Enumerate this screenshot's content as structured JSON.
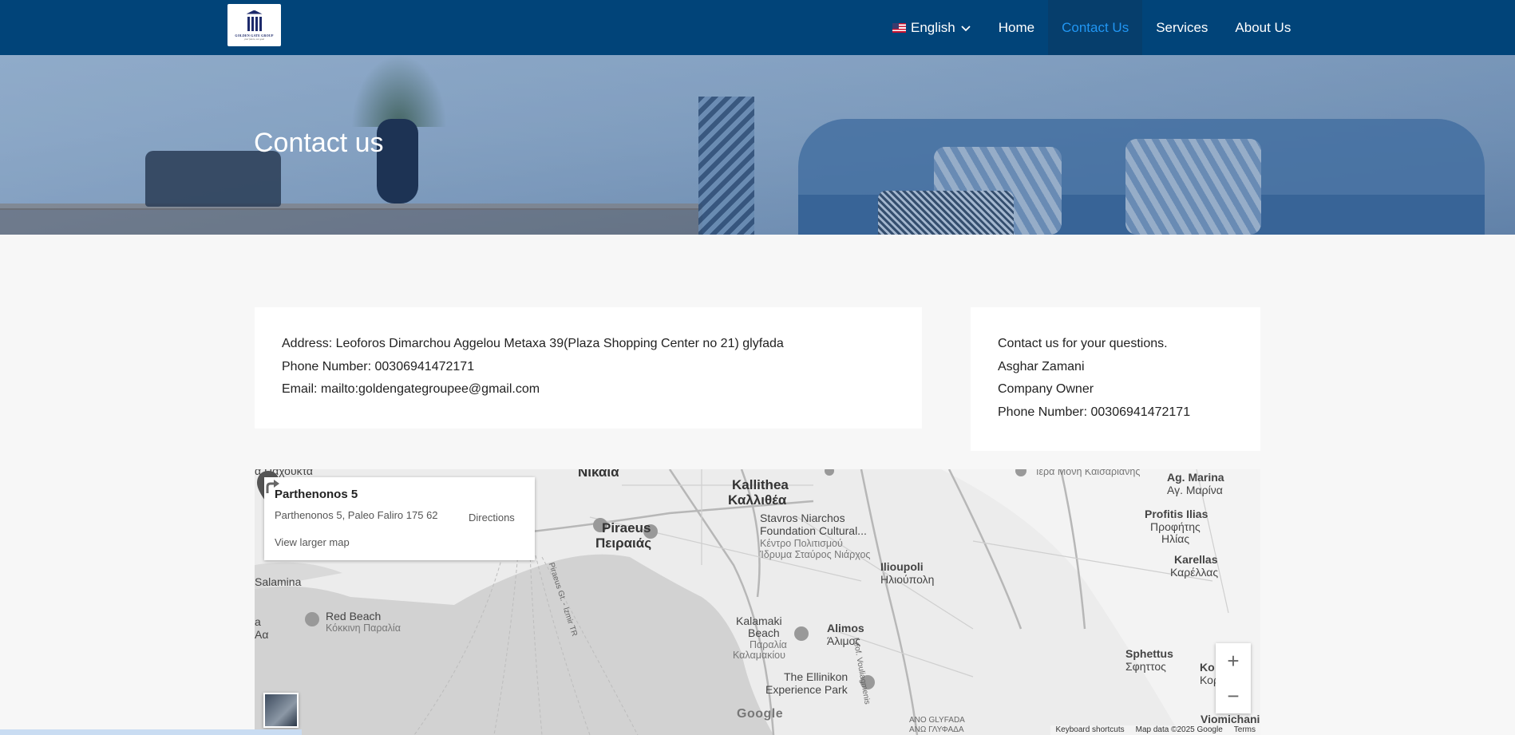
{
  "header": {
    "logo": {
      "text": "GOLDEN GATE GROUP",
      "tagline": "your future, our goal"
    },
    "language": {
      "label": "English",
      "flag": "us-flag-icon"
    },
    "nav": [
      {
        "label": "Home",
        "active": false
      },
      {
        "label": "Contact Us",
        "active": true
      },
      {
        "label": "Services",
        "active": false
      },
      {
        "label": "About Us",
        "active": false
      }
    ]
  },
  "hero": {
    "title": "Contact us"
  },
  "contact_card": {
    "address": "Address: Leoforos Dimarchou Aggelou Metaxa 39(Plaza Shopping Center no 21) glyfada",
    "phone": "Phone Number: 00306941472171",
    "email": "Email: mailto:goldengategroupee@gmail.com"
  },
  "owner_card": {
    "intro": "Contact us for your questions.",
    "name": "Asghar Zamani",
    "role": "Company Owner",
    "phone": "Phone Number: 00306941472171"
  },
  "map": {
    "place_title": "Parthenonos 5",
    "place_address": "Parthenonos 5, Paleo Faliro 175 62",
    "directions_label": "Directions",
    "larger_map_label": "View larger map",
    "zoom_in": "+",
    "zoom_out": "−",
    "google_label": "Google",
    "attribution": {
      "shortcuts": "Keyboard shortcuts",
      "data": "Map data ©2025 Google",
      "terms": "Terms"
    },
    "labels": {
      "nikaia": "Νίκαια",
      "pachovita": "α Παχούκτα",
      "kallithea_en": "Kallithea",
      "kallithea_gr": "Καλλιθέα",
      "piraeus_en": "Piraeus",
      "piraeus_gr": "Πειραιάς",
      "snfcc_en1": "Stavros Niarchos",
      "snfcc_en2": "Foundation Cultural...",
      "snfcc_gr1": "Κέντρο Πολιτισμού",
      "snfcc_gr2": "Ίδρυμα Σταύρος Νιάρχος",
      "kaisariani": "Ιερά Μονή Καισαριανής",
      "ag_marina_en": "Ag. Marina",
      "ag_marina_gr": "Αγ. Μαρίνα",
      "profitis_en": "Profitis Ilias",
      "profitis_gr1": "Προφήτης",
      "profitis_gr2": "Ηλίας",
      "karellas_en": "Karellas",
      "karellas_gr": "Καρέλλας",
      "salamina": "Salamina",
      "ilioupoli_en": "Ilioupoli",
      "ilioupoli_gr": "Ηλιούπολη",
      "red_beach_en": "Red Beach",
      "red_beach_gr": "Κόκκινη Παραλία",
      "a_left": "a",
      "aa_left": "Αα",
      "kalamaki_en1": "Kalamaki",
      "kalamaki_en2": "Beach",
      "kalamaki_gr1": "Παραλία",
      "kalamaki_gr2": "Καλαμακίου",
      "alimos_en": "Alimos",
      "alimos_gr": "Άλιμος",
      "ellinikon_en1": "The Ellinikon",
      "ellinikon_en2": "Experience Park",
      "sphettus_en": "Sphettus",
      "sphettus_gr": "Σφηττος",
      "ko_en": "Ko",
      "ko_gr": "Κορ",
      "viomichaniki": "Viomichaniki",
      "ano_glyfada_en": "ANO GLYFADA",
      "ano_glyfada_gr": "ΑΝΩ ΓΛΥΦΑΔΑ",
      "vouliagmenis": "Leof. Vouliagmenis",
      "piraeus_route": "Piraeus Gt. - Izmir TR"
    }
  },
  "colors": {
    "navbar": "#014479",
    "nav_active_text": "#2196f3",
    "page_bg": "#f7f7f7"
  }
}
